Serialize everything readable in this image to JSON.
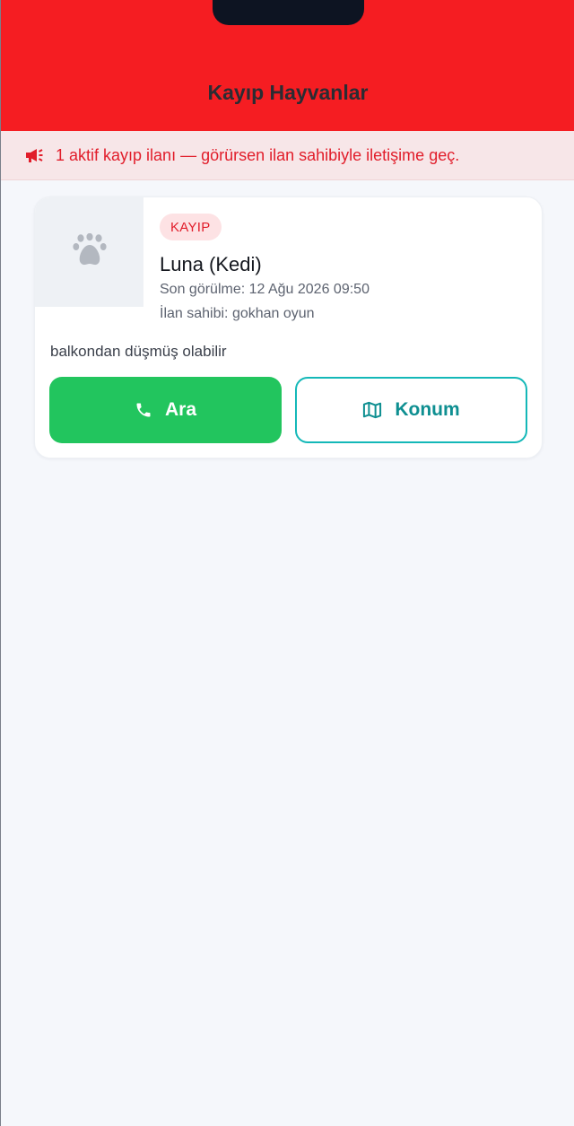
{
  "header": {
    "title": "Kayıp Hayvanlar",
    "color": "#f51d22"
  },
  "notice": {
    "icon": "megaphone-icon",
    "text": "1 aktif kayıp ilanı — görürsen ilan sahibiyle iletişime geç."
  },
  "listing": {
    "photo_icon": "paw-icon",
    "badge": "KAYIP",
    "name": "Luna (Kedi)",
    "last_seen": "Son görülme: 12 Ağu 2026 09:50",
    "owner": "İlan sahibi: gokhan oyun",
    "description": "balkondan düşmüş olabilir",
    "call_button": {
      "label": "Ara",
      "icon": "phone-icon",
      "color": "#22c55e"
    },
    "location_button": {
      "label": "Konum",
      "icon": "map-icon",
      "color": "#0e8f91"
    }
  }
}
